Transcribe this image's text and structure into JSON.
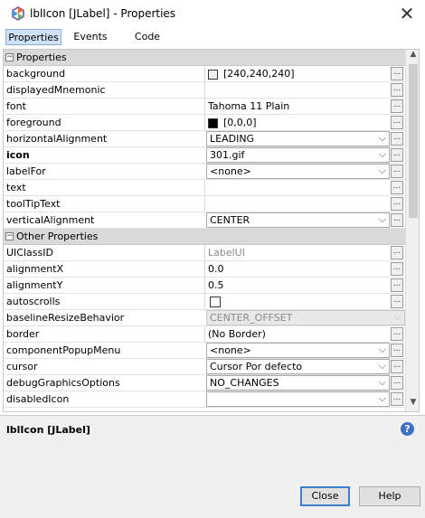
{
  "window": {
    "title": "lblIcon [JLabel] - Properties",
    "close_glyph": "✕"
  },
  "tabs": [
    {
      "label": "Properties",
      "active": true
    },
    {
      "label": "Events",
      "active": false
    },
    {
      "label": "Code",
      "active": false
    }
  ],
  "categories": [
    {
      "label": "Properties",
      "expanded": true
    },
    {
      "label": "Other Properties",
      "expanded": true
    }
  ],
  "properties": [
    {
      "name": "background",
      "value": "[240,240,240]",
      "kind": "color",
      "swatch": "#f0f0f0"
    },
    {
      "name": "displayedMnemonic",
      "value": "",
      "kind": "text"
    },
    {
      "name": "font",
      "value": "Tahoma 11 Plain",
      "kind": "text"
    },
    {
      "name": "foreground",
      "value": "[0,0,0]",
      "kind": "color",
      "swatch": "#000000"
    },
    {
      "name": "horizontalAlignment",
      "value": "LEADING",
      "kind": "combo"
    },
    {
      "name": "icon",
      "value": "301.gif",
      "kind": "combo",
      "bold": true
    },
    {
      "name": "labelFor",
      "value": "<none>",
      "kind": "combo"
    },
    {
      "name": "text",
      "value": "",
      "kind": "text"
    },
    {
      "name": "toolTipText",
      "value": "",
      "kind": "text"
    },
    {
      "name": "verticalAlignment",
      "value": "CENTER",
      "kind": "combo"
    }
  ],
  "other_properties": [
    {
      "name": "UIClassID",
      "value": "LabelUI",
      "kind": "readonly"
    },
    {
      "name": "alignmentX",
      "value": "0.0",
      "kind": "text"
    },
    {
      "name": "alignmentY",
      "value": "0.5",
      "kind": "text"
    },
    {
      "name": "autoscrolls",
      "value": "",
      "kind": "checkbox",
      "checked": false
    },
    {
      "name": "baselineResizeBehavior",
      "value": "CENTER_OFFSET",
      "kind": "combo-disabled"
    },
    {
      "name": "border",
      "value": "(No Border)",
      "kind": "text"
    },
    {
      "name": "componentPopupMenu",
      "value": "<none>",
      "kind": "combo"
    },
    {
      "name": "cursor",
      "value": "Cursor Por defecto",
      "kind": "combo"
    },
    {
      "name": "debugGraphicsOptions",
      "value": "NO_CHANGES",
      "kind": "combo"
    },
    {
      "name": "disabledIcon",
      "value": "",
      "kind": "combo"
    }
  ],
  "ellipsis_label": "...",
  "combo_arrow": "⌵",
  "info": {
    "title": "lblIcon [JLabel]",
    "help_glyph": "?"
  },
  "buttons": {
    "close": "Close",
    "help": "Help"
  },
  "colors": {
    "accent": "#3c7fd1",
    "category_bg": "#d9d9d9",
    "tab_active_bg": "#cfe2f7"
  }
}
